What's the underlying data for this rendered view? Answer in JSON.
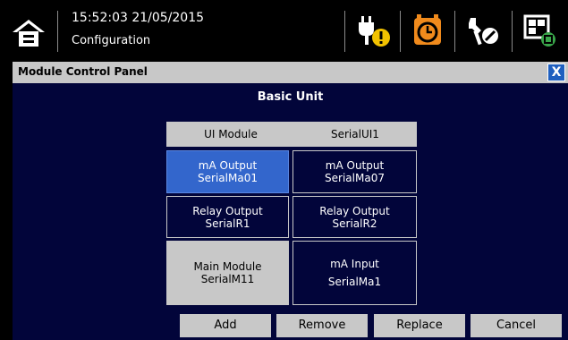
{
  "header": {
    "datetime": "15:52:03 21/05/2015",
    "mode": "Configuration",
    "icons": [
      "home-icon",
      "power-plug-warning-icon",
      "alarm-clock-icon",
      "tools-icon",
      "module-grid-icon"
    ]
  },
  "panel": {
    "title": "Module Control Panel",
    "close_label": "X",
    "subtitle": "Basic Unit",
    "header_row": {
      "left": "UI Module",
      "right": "SerialUI1"
    },
    "modules": [
      {
        "name": "mA Output",
        "serial": "SerialMa01"
      },
      {
        "name": "mA Output",
        "serial": "SerialMa07"
      },
      {
        "name": "Relay Output",
        "serial": "SerialR1"
      },
      {
        "name": "Relay Output",
        "serial": "SerialR2"
      },
      {
        "name": "Main Module",
        "serial": "SerialM11"
      },
      {
        "name": "mA Input",
        "serial": "SerialMa1"
      }
    ]
  },
  "buttons": {
    "add": "Add",
    "remove": "Remove",
    "replace": "Replace",
    "cancel": "Cancel"
  },
  "colors": {
    "panel_bg": "#02053a",
    "selected": "#3366cc",
    "grey": "#c8c8c8",
    "accent_orange": "#f08a1c",
    "warning_yellow": "#f2c200"
  }
}
